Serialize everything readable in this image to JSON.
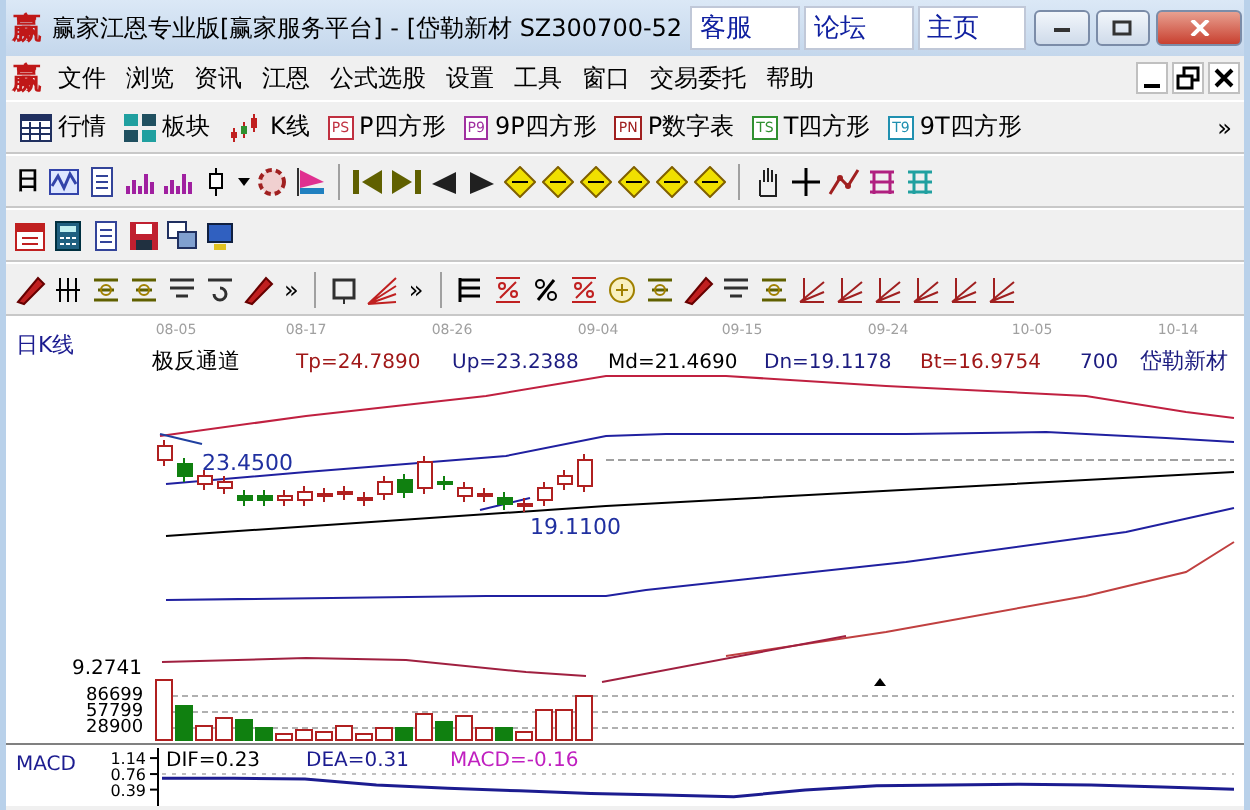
{
  "window": {
    "logo": "赢",
    "title": "赢家江恩专业版[赢家服务平台] - [岱勒新材   SZ300700-52",
    "links": [
      "客服",
      "论坛",
      "主页"
    ]
  },
  "menu": {
    "logo": "赢",
    "items": [
      "文件",
      "浏览",
      "资讯",
      "江恩",
      "公式选股",
      "设置",
      "工具",
      "窗口",
      "交易委托",
      "帮助"
    ]
  },
  "toolbar": {
    "buttons": [
      {
        "label": "行情",
        "kind": "table"
      },
      {
        "label": "板块",
        "kind": "blocks"
      },
      {
        "label": "K线",
        "kind": "candles"
      },
      {
        "label": "P四方形",
        "kind": "badge",
        "badge": "PS",
        "color": "#c03040"
      },
      {
        "label": "9P四方形",
        "kind": "badge",
        "badge": "P9",
        "color": "#a030a0"
      },
      {
        "label": "P数字表",
        "kind": "badge",
        "badge": "PN",
        "color": "#a02020"
      },
      {
        "label": "T四方形",
        "kind": "badge",
        "badge": "TS",
        "color": "#309030"
      },
      {
        "label": "9T四方形",
        "kind": "badge",
        "badge": "T9",
        "color": "#2090b0"
      }
    ],
    "overflow": "»"
  },
  "period": {
    "label": "日"
  },
  "drawing_tools": {
    "overflow": [
      "»",
      "»"
    ]
  },
  "chart": {
    "period_label": "日K线",
    "dates": [
      "08-05",
      "08-17",
      "08-26",
      "09-04",
      "09-15",
      "09-24",
      "10-05",
      "10-14"
    ],
    "indicator": "极反通道",
    "readings": [
      {
        "text": "Tp=24.7890",
        "color": "#a01818"
      },
      {
        "text": "Up=23.2388",
        "color": "#1c1c80"
      },
      {
        "text": "Md=21.4690",
        "color": "#000000"
      },
      {
        "text": "Dn=19.1178",
        "color": "#1c1c80"
      },
      {
        "text": "Bt=16.9754",
        "color": "#a01818"
      }
    ],
    "stock_code": "700",
    "stock_name": "岱勒新材",
    "high_label": "23.4500",
    "low_label": "19.1100"
  },
  "volume": {
    "max_label": "9.2741",
    "ticks": [
      "86699",
      "57799",
      "28900"
    ]
  },
  "macd": {
    "label": "MACD",
    "chart_data": {
      "type": "line",
      "ylim": [
        0,
        1.38
      ],
      "yticks": [
        {
          "value": 1.14,
          "label": "1.14"
        },
        {
          "value": 0.76,
          "label": "0.76"
        },
        {
          "value": 0.39,
          "label": "0.39"
        }
      ],
      "series": [
        {
          "color": "#1c1c90",
          "values": [
            0.66,
            0.66,
            0.64,
            0.5,
            0.42,
            0.36,
            0.3,
            0.26,
            0.22,
            0.38,
            0.48,
            0.5,
            0.52,
            0.5,
            0.45,
            0.4
          ]
        }
      ]
    },
    "readings": [
      {
        "text": "DIF=0.23",
        "color": "#000000"
      },
      {
        "text": "DEA=0.31",
        "color": "#1c1c90"
      },
      {
        "text": "MACD=-0.16",
        "color": "#c020c0"
      }
    ]
  }
}
